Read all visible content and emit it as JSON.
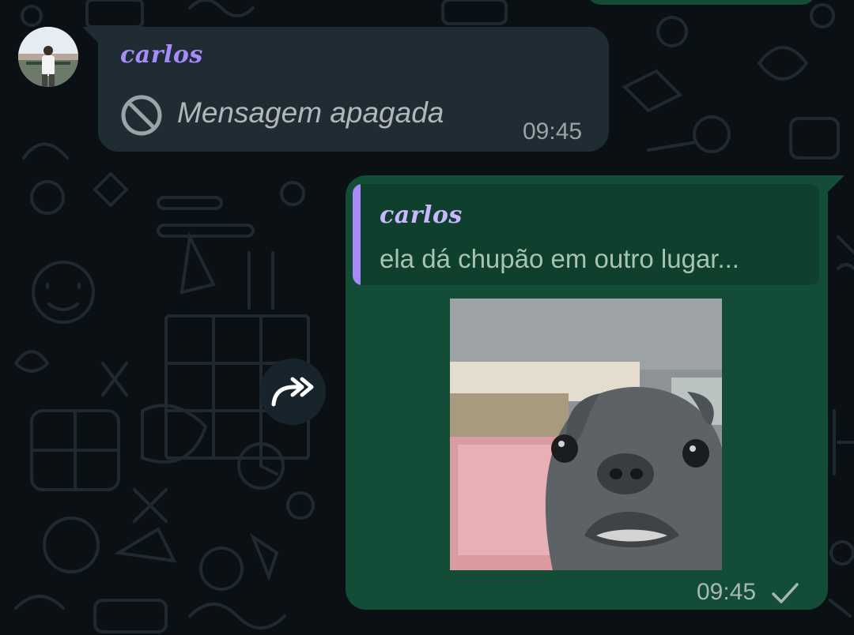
{
  "incoming_message": {
    "sender": "carlos",
    "text": "Mensagem apagada",
    "time": "09:45",
    "icon": "blocked-icon",
    "avatar": "profile-photo"
  },
  "outgoing_message": {
    "quote": {
      "sender": "carlos",
      "text": "ela dá chupão em outro lugar..."
    },
    "media": "gif-sticker-puppy",
    "time": "09:45",
    "status_icon": "single-check-icon"
  },
  "forward_button": {
    "icon": "forward-icon"
  },
  "colors": {
    "background": "#0b1014",
    "incoming_bubble": "#202c33",
    "outgoing_bubble": "#144d37",
    "quote_accent": "#a78bfa"
  }
}
